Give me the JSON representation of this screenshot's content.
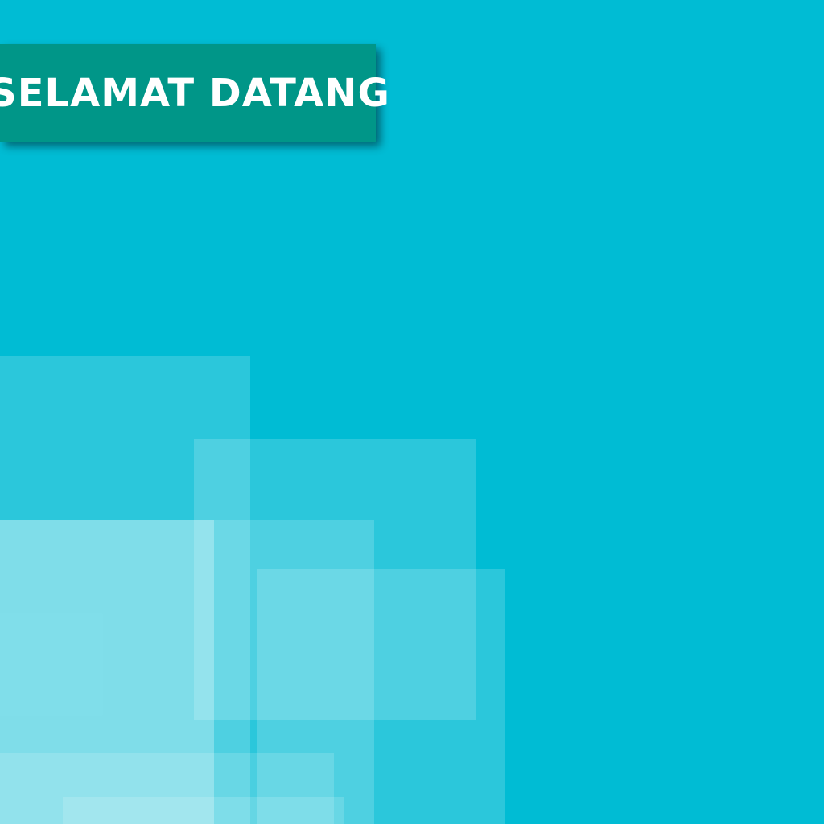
{
  "banner": {
    "title": "SELAMAT DATANG"
  },
  "colors": {
    "background": "#00BCD4",
    "banner": "#009688",
    "text": "#FFFFFF"
  }
}
